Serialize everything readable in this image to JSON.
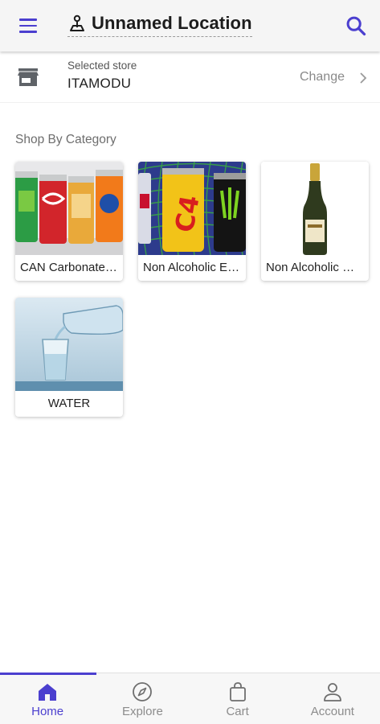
{
  "header": {
    "location_title": "Unnamed Location",
    "menu_icon": "hamburger-menu-icon",
    "location_icon": "map-pin-icon",
    "search_icon": "search-icon"
  },
  "store": {
    "caption": "Selected store",
    "name": "ITAMODU",
    "change_label": "Change",
    "icon": "storefront-icon"
  },
  "section": {
    "title": "Shop By Category"
  },
  "categories": [
    {
      "label": "CAN Carbonated Drinks",
      "image": "cans-soda-image"
    },
    {
      "label": "Non Alcoholic Energy Drinks",
      "image": "energy-cans-image"
    },
    {
      "label": "Non Alcoholic Wine",
      "image": "wine-bottle-image"
    },
    {
      "label": "WATER",
      "image": "water-pour-image"
    }
  ],
  "bottom_nav": {
    "items": [
      {
        "label": "Home",
        "icon": "home-icon",
        "active": true
      },
      {
        "label": "Explore",
        "icon": "compass-icon",
        "active": false
      },
      {
        "label": "Cart",
        "icon": "shopping-bag-icon",
        "active": false
      },
      {
        "label": "Account",
        "icon": "person-icon",
        "active": false
      }
    ]
  },
  "colors": {
    "accent": "#4b3fcf",
    "header_bg": "#f5f5f5",
    "muted_text": "#8a8a8a"
  }
}
